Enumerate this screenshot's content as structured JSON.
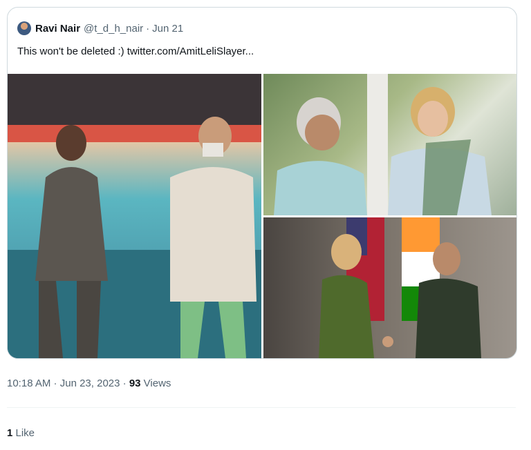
{
  "quoted": {
    "author_name": "Ravi Nair",
    "handle": "@t_d_h_nair",
    "separator": "·",
    "date": "Jun 21",
    "text": "This won't be deleted :)  twitter.com/AmitLeliSlayer..."
  },
  "media": [
    {
      "name": "photo-1"
    },
    {
      "name": "photo-2"
    },
    {
      "name": "photo-3"
    }
  ],
  "meta": {
    "time": "10:18 AM",
    "sep1": " · ",
    "date": "Jun 23, 2023",
    "sep2": " · ",
    "views_count": "93",
    "views_label": " Views"
  },
  "engagement": {
    "likes_count": "1",
    "likes_label": " Like"
  },
  "colors": {
    "text": "#0f1419",
    "muted": "#536471",
    "border": "#cfd9de"
  }
}
